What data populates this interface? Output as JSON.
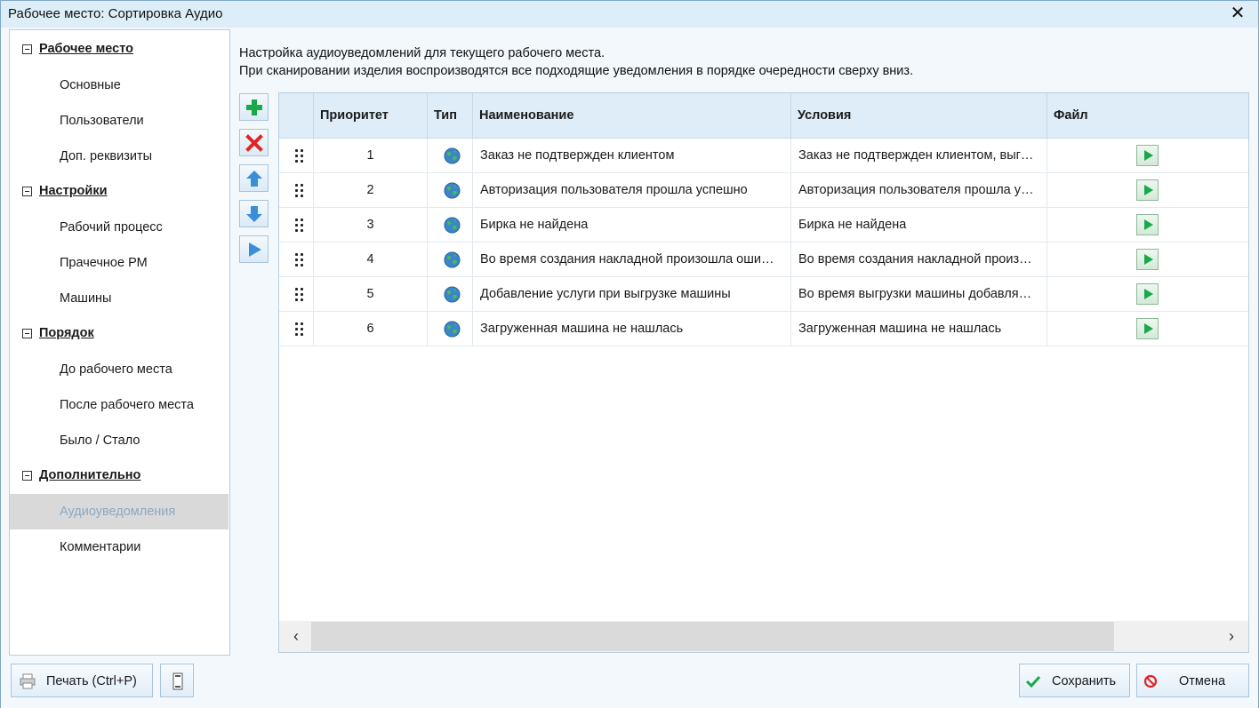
{
  "window": {
    "title": "Рабочее место: Сортировка Аудио",
    "close_glyph": "✕"
  },
  "sidebar": {
    "groups": [
      {
        "title": "Рабочее место",
        "items": [
          "Основные",
          "Пользователи",
          "Доп. реквизиты"
        ]
      },
      {
        "title": "Настройки",
        "items": [
          "Рабочий процесс",
          "Прачечное РМ",
          "Машины"
        ]
      },
      {
        "title": "Порядок",
        "items": [
          "До рабочего места",
          "После рабочего места",
          "Было / Стало"
        ]
      },
      {
        "title": "Дополнительно",
        "items": [
          "Аудиоуведомления",
          "Комментарии"
        ]
      }
    ],
    "active_item": "Аудиоуведомления"
  },
  "main": {
    "description_line1": "Настройка аудиоуведомлений для текущего рабочего места.",
    "description_line2": "При сканировании изделия воспроизводятся все подходящие уведомления в порядке очередности сверху вниз.",
    "toolbar": {
      "add_icon": "plus-icon",
      "delete_icon": "delete-icon",
      "move_up_icon": "arrow-up-icon",
      "move_down_icon": "arrow-down-icon",
      "play_icon": "play-icon"
    },
    "table": {
      "columns": [
        "Приоритет",
        "Тип",
        "Наименование",
        "Условия",
        "Файл"
      ],
      "rows": [
        {
          "priority": "1",
          "type_icon": "globe-icon",
          "name": "Заказ не подтвержден клиентом",
          "condition": "Заказ не подтвержден клиентом, выг…"
        },
        {
          "priority": "2",
          "type_icon": "globe-icon",
          "name": "Авторизация пользователя прошла успешно",
          "condition": "Авторизация пользователя прошла у…"
        },
        {
          "priority": "3",
          "type_icon": "globe-icon",
          "name": "Бирка не найдена",
          "condition": "Бирка не найдена"
        },
        {
          "priority": "4",
          "type_icon": "globe-icon",
          "name": "Во время создания накладной произошла оши…",
          "condition": "Во время создания накладной произ…"
        },
        {
          "priority": "5",
          "type_icon": "globe-icon",
          "name": "Добавление услуги при выгрузке машины",
          "condition": "Во время выгрузки машины добавля…"
        },
        {
          "priority": "6",
          "type_icon": "globe-icon",
          "name": "Загруженная машина не нашлась",
          "condition": "Загруженная машина не нашлась"
        }
      ]
    },
    "scrollbar": {
      "left_glyph": "‹",
      "right_glyph": "›"
    }
  },
  "footer": {
    "print_label": "Печать (Ctrl+P)",
    "save_label": "Сохранить",
    "cancel_label": "Отмена"
  },
  "colors": {
    "accent_green": "#19a94a",
    "delete_red": "#e02424",
    "arrow_blue": "#3a8ed8",
    "window_bg": "#ddeef8"
  }
}
